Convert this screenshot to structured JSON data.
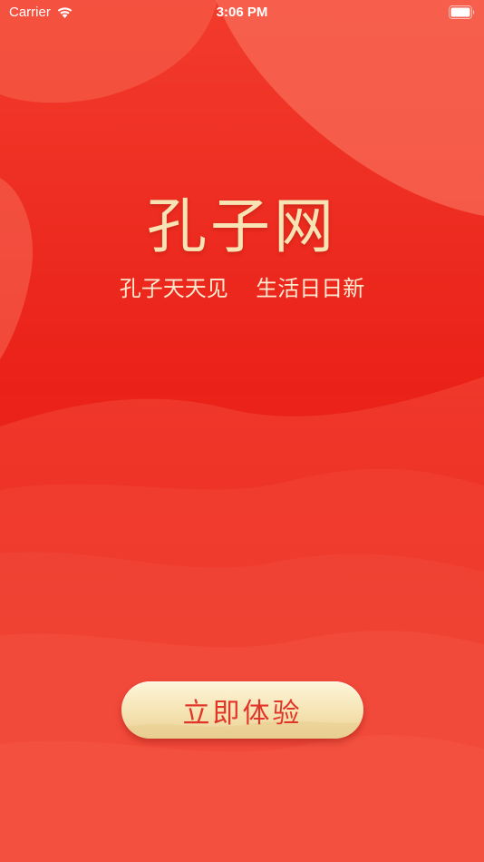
{
  "status_bar": {
    "carrier": "Carrier",
    "time": "3:06 PM",
    "wifi_icon": "wifi-icon",
    "battery_icon": "battery-icon"
  },
  "splash": {
    "title": "孔子网",
    "slogan": "孔子天天见    生活日日新"
  },
  "cta": {
    "label": "立即体验"
  },
  "colors": {
    "background": "#ee2a1f",
    "title": "#f7e3b4",
    "button_text": "#e2352a",
    "button_fill": "#f5e3b2"
  }
}
